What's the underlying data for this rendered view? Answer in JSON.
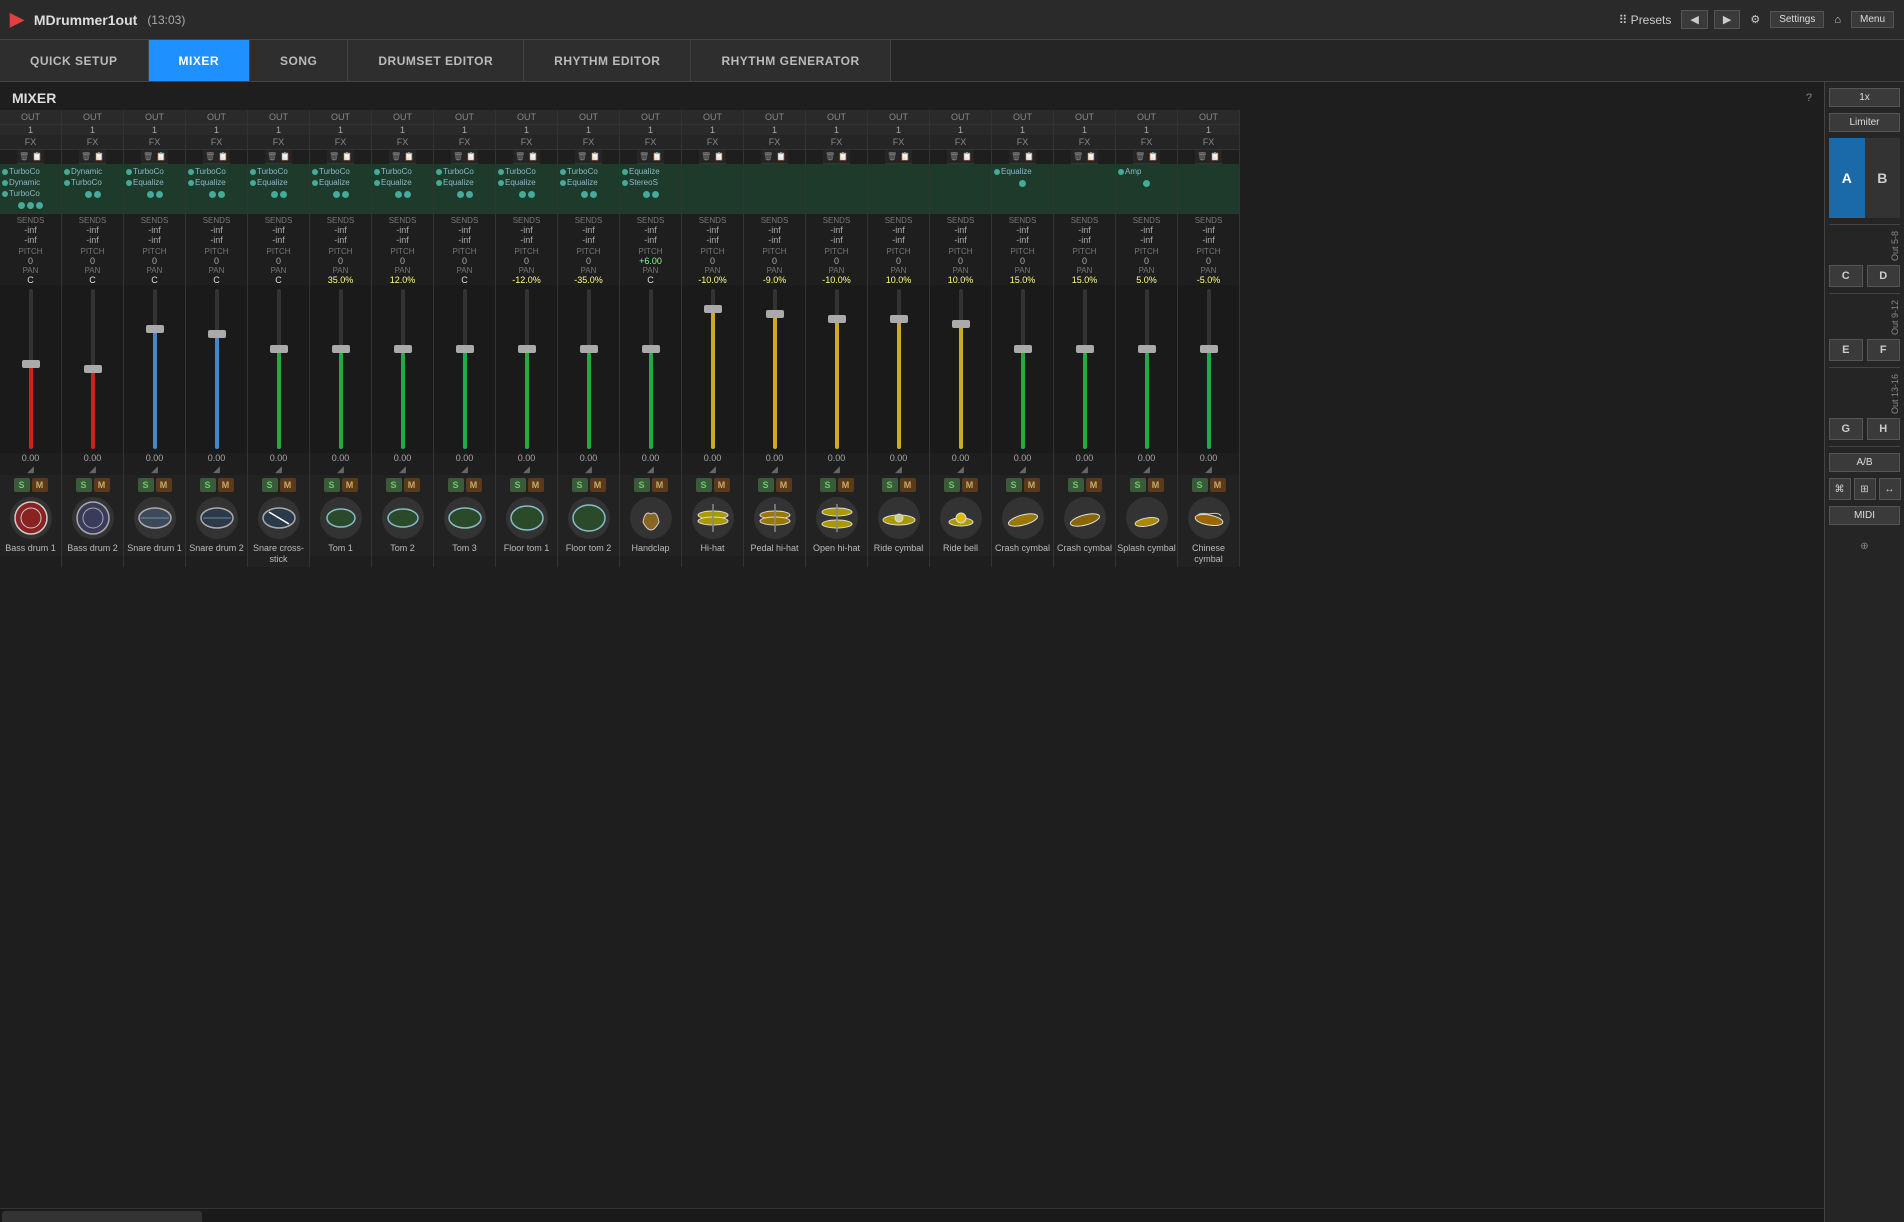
{
  "app": {
    "name": "MDrummer1out",
    "time": "(13:03)",
    "logo": "▶"
  },
  "topbar": {
    "presets_label": "⠿ Presets",
    "nav_left": "◀",
    "nav_right": "▶",
    "settings_icon": "⚙",
    "settings_label": "Settings",
    "home_icon": "⌂",
    "menu_icon": "☰",
    "menu_label": "Menu"
  },
  "tabs": [
    {
      "id": "quick-setup",
      "label": "QUICK SETUP",
      "active": false
    },
    {
      "id": "mixer",
      "label": "MIXER",
      "active": true
    },
    {
      "id": "song",
      "label": "SONG",
      "active": false
    },
    {
      "id": "drumset-editor",
      "label": "DRUMSET EDITOR",
      "active": false
    },
    {
      "id": "rhythm-editor",
      "label": "RHYTHM EDITOR",
      "active": false
    },
    {
      "id": "rhythm-generator",
      "label": "RHYTHM GENERATOR",
      "active": false
    }
  ],
  "mixer": {
    "title": "MIXER",
    "help": "?"
  },
  "sidebar_right": {
    "multiplier": "1x",
    "limiter": "Limiter",
    "a_label": "A",
    "b_label": "B",
    "c_label": "C",
    "d_label": "D",
    "e_label": "E",
    "f_label": "F",
    "g_label": "G",
    "h_label": "H",
    "out_5_8": "Out 5-8",
    "out_9_12": "Out 9-12",
    "out_13_16": "Out 13-16",
    "ab_label": "A/B",
    "midi_label": "MIDI"
  },
  "channels": [
    {
      "id": "bass-drum-1",
      "out": "OUT",
      "out_num": "1",
      "fx": "FX",
      "plugins": [
        "TurboCo",
        "Dynamic",
        "TurboCo"
      ],
      "sends1": "-inf",
      "sends2": "-inf",
      "pitch": "0",
      "pan": "C",
      "fader_db": "0.00",
      "fader_type": "red",
      "fader_height": 85,
      "name": "Bass drum 1",
      "icon_color": "#8B2222"
    },
    {
      "id": "bass-drum-2",
      "out": "OUT",
      "out_num": "1",
      "fx": "FX",
      "plugins": [
        "Dynamic",
        "TurboCo"
      ],
      "sends1": "-inf",
      "sends2": "-inf",
      "pitch": "0",
      "pan": "C",
      "fader_db": "0.00",
      "fader_type": "red",
      "fader_height": 80,
      "name": "Bass drum 2",
      "icon_color": "#3366aa"
    },
    {
      "id": "snare-drum-1",
      "out": "OUT",
      "out_num": "1",
      "fx": "FX",
      "plugins": [
        "TurboCo",
        "Equalize"
      ],
      "sends1": "-inf",
      "sends2": "-inf",
      "pitch": "0",
      "pan": "C",
      "fader_db": "0.00",
      "fader_type": "blue",
      "fader_height": 120,
      "name": "Snare drum 1",
      "icon_color": "#4488bb"
    },
    {
      "id": "snare-drum-2",
      "out": "OUT",
      "out_num": "1",
      "fx": "FX",
      "plugins": [
        "TurboCo",
        "Equalize"
      ],
      "sends1": "-inf",
      "sends2": "-inf",
      "pitch": "0",
      "pan": "C",
      "fader_db": "0.00",
      "fader_type": "blue",
      "fader_height": 115,
      "name": "Snare drum 2",
      "icon_color": "#335599"
    },
    {
      "id": "snare-cross-stick",
      "out": "OUT",
      "out_num": "1",
      "fx": "FX",
      "plugins": [
        "TurboCo",
        "Equalize"
      ],
      "sends1": "-inf",
      "sends2": "-inf",
      "pitch": "0",
      "pan": "C",
      "fader_db": "0.00",
      "fader_type": "green",
      "fader_height": 100,
      "name": "Snare cross-stick",
      "icon_color": "#335599"
    },
    {
      "id": "tom-1",
      "out": "OUT",
      "out_num": "1",
      "fx": "FX",
      "plugins": [
        "TurboCo",
        "Equalize"
      ],
      "sends1": "-inf",
      "sends2": "-inf",
      "pitch": "0",
      "pan": "35.0%",
      "fader_db": "0.00",
      "fader_type": "green",
      "fader_height": 100,
      "name": "Tom 1",
      "icon_color": "#224422"
    },
    {
      "id": "tom-2",
      "out": "OUT",
      "out_num": "1",
      "fx": "FX",
      "plugins": [
        "TurboCo",
        "Equalize"
      ],
      "sends1": "-inf",
      "sends2": "-inf",
      "pitch": "0",
      "pan": "12.0%",
      "fader_db": "0.00",
      "fader_type": "green",
      "fader_height": 100,
      "name": "Tom 2",
      "icon_color": "#224422"
    },
    {
      "id": "tom-3",
      "out": "OUT",
      "out_num": "1",
      "fx": "FX",
      "plugins": [
        "TurboCo",
        "Equalize"
      ],
      "sends1": "-inf",
      "sends2": "-inf",
      "pitch": "0",
      "pan": "C",
      "fader_db": "0.00",
      "fader_type": "green",
      "fader_height": 100,
      "name": "Tom 3",
      "icon_color": "#224422"
    },
    {
      "id": "floor-tom-1",
      "out": "OUT",
      "out_num": "1",
      "fx": "FX",
      "plugins": [
        "TurboCo",
        "Equalize"
      ],
      "sends1": "-inf",
      "sends2": "-inf",
      "pitch": "0",
      "pan": "-12.0%",
      "fader_db": "0.00",
      "fader_type": "green",
      "fader_height": 100,
      "name": "Floor tom 1",
      "icon_color": "#224422"
    },
    {
      "id": "floor-tom-2",
      "out": "OUT",
      "out_num": "1",
      "fx": "FX",
      "plugins": [
        "TurboCo",
        "Equalize"
      ],
      "sends1": "-inf",
      "sends2": "-inf",
      "pitch": "0",
      "pan": "-35.0%",
      "fader_db": "0.00",
      "fader_type": "green",
      "fader_height": 100,
      "name": "Floor tom 2",
      "icon_color": "#224422"
    },
    {
      "id": "handclap",
      "out": "OUT",
      "out_num": "1",
      "fx": "FX",
      "plugins": [
        "Equalize",
        "StereoS"
      ],
      "sends1": "-inf",
      "sends2": "-inf",
      "pitch": "+6.00",
      "pan": "C",
      "fader_db": "0.00",
      "fader_type": "green",
      "fader_height": 100,
      "name": "Handclap",
      "icon_color": "#886622"
    },
    {
      "id": "hi-hat",
      "out": "OUT",
      "out_num": "1",
      "fx": "FX",
      "plugins": [],
      "sends1": "-inf",
      "sends2": "-inf",
      "pitch": "0",
      "pan": "-10.0%",
      "fader_db": "0.00",
      "fader_type": "yellow",
      "fader_height": 140,
      "name": "Hi-hat",
      "icon_color": "#887722"
    },
    {
      "id": "pedal-hi-hat",
      "out": "OUT",
      "out_num": "1",
      "fx": "FX",
      "plugins": [],
      "sends1": "-inf",
      "sends2": "-inf",
      "pitch": "0",
      "pan": "-9.0%",
      "fader_db": "0.00",
      "fader_type": "yellow",
      "fader_height": 135,
      "name": "Pedal hi-hat",
      "icon_color": "#887722"
    },
    {
      "id": "open-hi-hat",
      "out": "OUT",
      "out_num": "1",
      "fx": "FX",
      "plugins": [],
      "sends1": "-inf",
      "sends2": "-inf",
      "pitch": "0",
      "pan": "-10.0%",
      "fader_db": "0.00",
      "fader_type": "yellow",
      "fader_height": 130,
      "name": "Open hi-hat",
      "icon_color": "#887722"
    },
    {
      "id": "ride-cymbal",
      "out": "OUT",
      "out_num": "1",
      "fx": "FX",
      "plugins": [],
      "sends1": "-inf",
      "sends2": "-inf",
      "pitch": "0",
      "pan": "10.0%",
      "fader_db": "0.00",
      "fader_type": "yellow",
      "fader_height": 130,
      "name": "Ride cymbal",
      "icon_color": "#887722"
    },
    {
      "id": "ride-bell",
      "out": "OUT",
      "out_num": "1",
      "fx": "FX",
      "plugins": [],
      "sends1": "-inf",
      "sends2": "-inf",
      "pitch": "0",
      "pan": "10.0%",
      "fader_db": "0.00",
      "fader_type": "yellow",
      "fader_height": 125,
      "name": "Ride bell",
      "icon_color": "#887722"
    },
    {
      "id": "crash-cymbal-1",
      "out": "OUT",
      "out_num": "1",
      "fx": "FX",
      "plugins": [
        "Equalize"
      ],
      "sends1": "-inf",
      "sends2": "-inf",
      "pitch": "0",
      "pan": "15.0%",
      "fader_db": "0.00",
      "fader_type": "green",
      "fader_height": 100,
      "name": "Crash cymbal",
      "icon_color": "#887722"
    },
    {
      "id": "crash-cymbal-2",
      "out": "OUT",
      "out_num": "1",
      "fx": "FX",
      "plugins": [],
      "sends1": "-inf",
      "sends2": "-inf",
      "pitch": "0",
      "pan": "15.0%",
      "fader_db": "0.00",
      "fader_type": "green",
      "fader_height": 100,
      "name": "Crash cymbal",
      "icon_color": "#887722"
    },
    {
      "id": "splash-cymbal",
      "out": "OUT",
      "out_num": "1",
      "fx": "FX",
      "plugins": [
        "Amp"
      ],
      "sends1": "-inf",
      "sends2": "-inf",
      "pitch": "0",
      "pan": "5.0%",
      "fader_db": "0.00",
      "fader_type": "green",
      "fader_height": 100,
      "name": "Splash cymbal",
      "icon_color": "#887722"
    },
    {
      "id": "chinese-cymbal",
      "out": "OUT",
      "out_num": "1",
      "fx": "FX",
      "plugins": [],
      "sends1": "-inf",
      "sends2": "-inf",
      "pitch": "0",
      "pan": "-5.0%",
      "fader_db": "0.00",
      "fader_type": "green",
      "fader_height": 100,
      "name": "Chinese cymbal",
      "icon_color": "#887722"
    }
  ]
}
